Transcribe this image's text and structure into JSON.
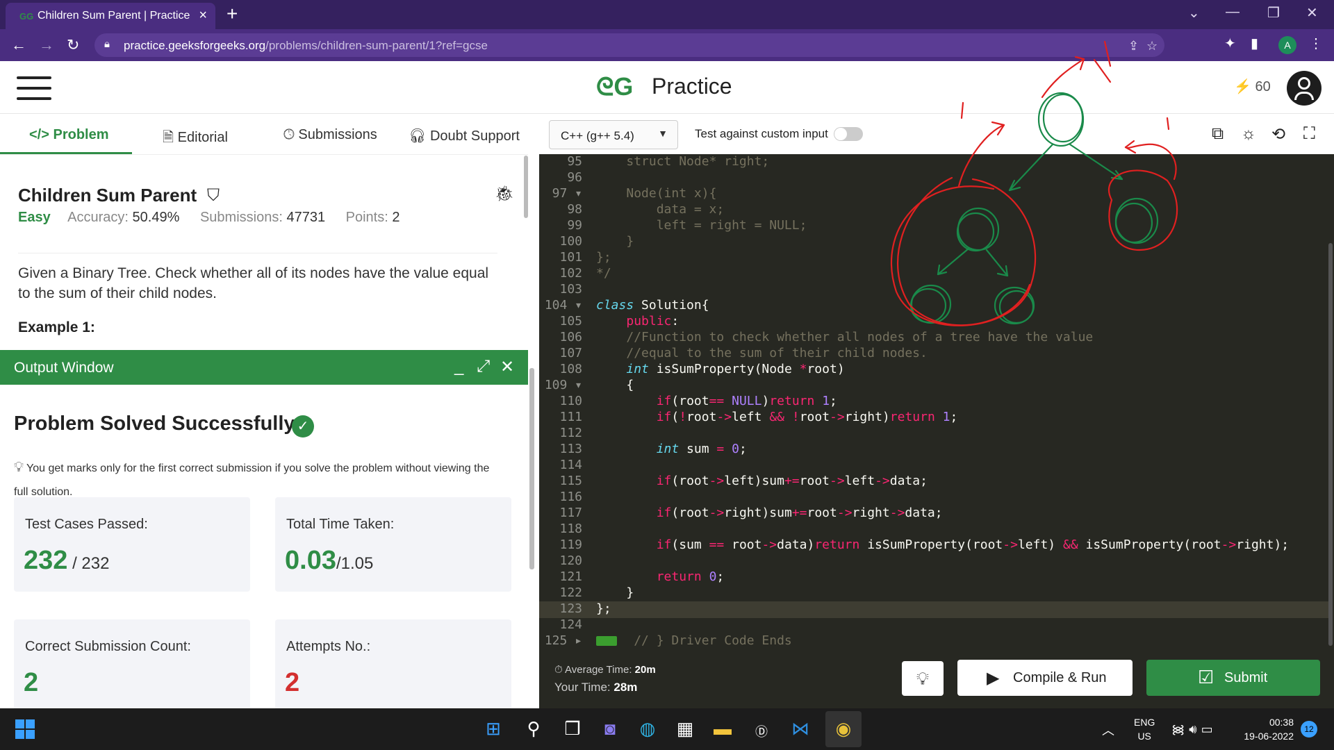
{
  "browser": {
    "tab_title": "Children Sum Parent | Practice | G",
    "tab_favicon": "GG",
    "url_host": "practice.geeksforgeeks.org",
    "url_path": "/problems/children-sum-parent/1?ref=gcse",
    "profile_initial": "A"
  },
  "header": {
    "logo": "ᘓG",
    "brand": "Practice",
    "streak": "60"
  },
  "left_tabs": {
    "problem": "</> Problem",
    "editorial": "Editorial",
    "submissions": "Submissions",
    "doubt_support": "Doubt Support"
  },
  "problem": {
    "title": "Children Sum Parent",
    "difficulty": "Easy",
    "accuracy_label": "Accuracy:",
    "accuracy": "50.49%",
    "submissions_label": "Submissions:",
    "submissions": "47731",
    "points_label": "Points:",
    "points": "2",
    "description": "Given a Binary Tree. Check whether all of its nodes have the value equal to the sum of their child nodes.",
    "example_heading": "Example 1:"
  },
  "output": {
    "window_title": "Output Window",
    "status": "Problem Solved Successfully",
    "tip": "You get marks only for the first correct submission if you solve the problem without viewing the full solution.",
    "cards": [
      {
        "label": "Test Cases Passed:",
        "value": "232",
        "total": " / 232"
      },
      {
        "label": "Total Time Taken:",
        "value": "0.03",
        "total": "/1.05"
      },
      {
        "label": "Correct Submission Count:",
        "value": "2",
        "total": ""
      },
      {
        "label": "Attempts No.:",
        "value": "2",
        "total": ""
      }
    ]
  },
  "editor_toolbar": {
    "language": "C++ (g++ 5.4)",
    "custom_input_label": "Test against custom input",
    "custom_input_enabled": false
  },
  "code": {
    "line_numbers": [
      "95",
      "96",
      "97",
      "98",
      "99",
      "100",
      "101",
      "102",
      "103",
      "104",
      "105",
      "106",
      "107",
      "108",
      "109",
      "110",
      "111",
      "112",
      "113",
      "114",
      "115",
      "116",
      "117",
      "118",
      "119",
      "120",
      "121",
      "122",
      "123",
      "124",
      "125"
    ],
    "fold_marks": [
      "",
      "",
      "▾",
      "",
      "",
      "",
      "",
      "",
      "",
      "▾",
      "",
      "",
      "",
      "",
      "▾",
      "",
      "",
      "",
      "",
      "",
      "",
      "",
      "",
      "",
      "",
      "",
      "",
      "",
      "",
      "",
      "▸"
    ]
  },
  "bottom": {
    "avg_time_label": "Average Time:",
    "avg_time": "20m",
    "your_time_label": "Your Time:",
    "your_time": "28m",
    "compile_run": "Compile & Run",
    "submit": "Submit"
  },
  "taskbar": {
    "lang_line1": "ENG",
    "lang_line2": "US",
    "time": "00:38",
    "date": "19-06-2022",
    "notifications": "12"
  },
  "colors": {
    "gfg_green": "#2f8d46",
    "chrome_purple": "#4a2d80",
    "editor_bg": "#272822",
    "annotation_red": "#e02020",
    "annotation_green": "#1a8a4a"
  }
}
